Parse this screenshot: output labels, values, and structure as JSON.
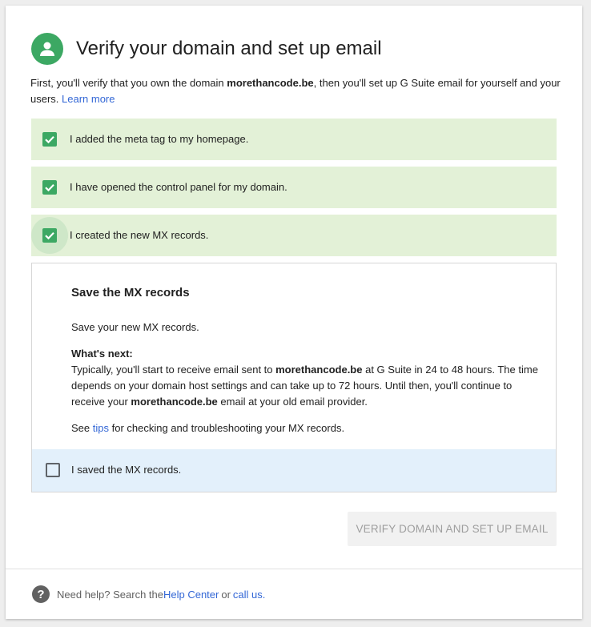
{
  "header": {
    "title": "Verify your domain and set up email",
    "avatar_icon": "person-icon",
    "accent_color": "#3ca863"
  },
  "intro": {
    "text_before": "First, you'll verify that you own the domain ",
    "domain": "morethancode.be",
    "text_after": ", then you'll set up G Suite email for yourself and your users. ",
    "learn_more": "Learn more"
  },
  "steps": [
    {
      "label": "I added the meta tag to my homepage.",
      "checked": true
    },
    {
      "label": "I have opened the control panel for my domain.",
      "checked": true
    },
    {
      "label": "I created the new MX records.",
      "checked": true
    }
  ],
  "panel": {
    "title": "Save the MX records",
    "save_text": "Save your new MX records.",
    "whats_next_label": "What's next:",
    "typically_a": "Typically, you'll start to receive email sent to ",
    "domain_1": "morethancode.be",
    "typically_b": " at G Suite in 24 to 48 hours. The time depends on your domain host settings and can take up to 72 hours. Until then, you'll continue to receive your ",
    "domain_2": "morethancode.be",
    "typically_c": " email at your old email provider.",
    "see_a": "See ",
    "tips_link": "tips",
    "see_b": " for checking and troubleshooting your MX records.",
    "final_step": {
      "label": "I saved the MX records.",
      "checked": false
    }
  },
  "verify_button": {
    "label": "VERIFY DOMAIN AND SET UP EMAIL"
  },
  "help": {
    "icon": "help-icon",
    "text_a": "Need help? Search the ",
    "help_center": "Help Center",
    "text_b": " or ",
    "call_us": "call us",
    "text_c": "."
  }
}
